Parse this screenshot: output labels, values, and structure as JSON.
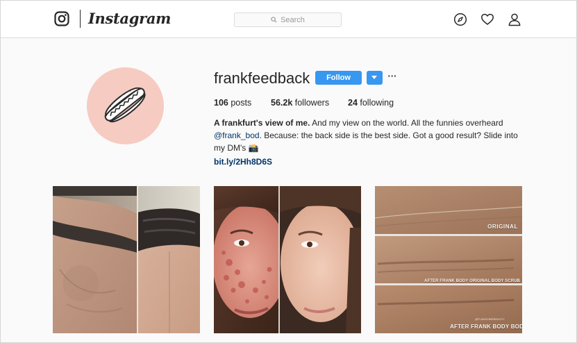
{
  "nav": {
    "logo_text": "Instagram",
    "search_placeholder": "Search",
    "icons": [
      "instagram-glyph-icon",
      "compass-icon",
      "heart-icon",
      "person-icon"
    ]
  },
  "profile": {
    "username": "frankfeedback",
    "follow_label": "Follow",
    "more_label": "···",
    "stats": {
      "posts_count": "106",
      "posts_label": " posts",
      "followers_count": "56.2k",
      "followers_label": " followers",
      "following_count": "24",
      "following_label": " following"
    },
    "bio": {
      "title": "A frankfurt's view of me.",
      "line1_rest": " And my view on the world. All the funnies overheard",
      "mention": "@frank_bod",
      "line2_rest": ". Because: the back side is the best side. Got a good result? Slide into",
      "line3": "my DM's 📸",
      "link": "bit.ly/2Hh8D6S"
    }
  },
  "posts": {
    "post3": {
      "label_original": "ORIGINAL",
      "label_scrub": "AFTER FRANK BODY ORIGINAL BODY SCRUB",
      "label_balm": "AFTER FRANK BODY BODY BALM",
      "label_handle": "@FLAWSOMEBEAUTY"
    }
  },
  "colors": {
    "accent": "#3897f0",
    "avatar_bg": "#f6cbc2",
    "link": "#003569",
    "page_bg": "#fafafa"
  }
}
